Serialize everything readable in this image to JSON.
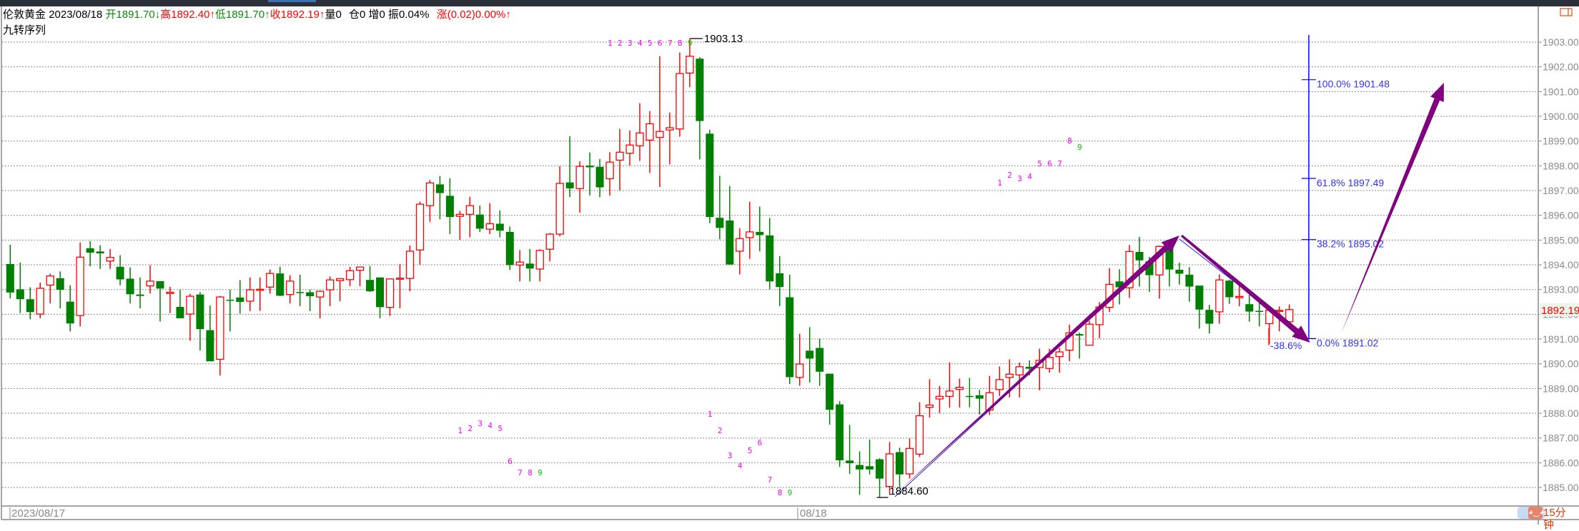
{
  "header": {
    "instrument": "伦敦黄金",
    "date": "2023/08/18",
    "open_label": "开",
    "open_value": "1891.70",
    "open_arrow": "↓",
    "high_label": "高",
    "high_value": "1892.40",
    "high_arrow": "↑",
    "low_label": "低",
    "low_value": "1891.70",
    "low_arrow": "↑",
    "close_label": "收",
    "close_value": "1892.19",
    "close_arrow": "↑",
    "volume": "量0",
    "position": "仓0",
    "increase": "增0",
    "amplitude": "振0.04%",
    "change": "涨(0.02)0.00%↑",
    "indicator": "九转序列"
  },
  "period_badge": "15分钟",
  "colors": {
    "up": "#ff0000",
    "down": "#008000",
    "arrow": "#800080",
    "fib": "#0000ff",
    "td": "#ff00ff",
    "td_nine": "#00cc00"
  },
  "chart_data": {
    "type": "candlestick",
    "title": "伦敦黄金",
    "ylim": [
      1884.45,
      1903.35
    ],
    "yticks": [
      1903,
      1902,
      1901,
      1900,
      1899,
      1898,
      1897,
      1896,
      1895,
      1894,
      1893,
      1892,
      1891,
      1890,
      1889,
      1888,
      1887,
      1886,
      1885
    ],
    "ytick_labels": [
      "1903.00",
      "1902.00",
      "1901.00",
      "1900.00",
      "1899.00",
      "1898.00",
      "1897.00",
      "1896.00",
      "1895.00",
      "1894.00",
      "1893.00",
      "1892.00",
      "1891.00",
      "1890.00",
      "1889.00",
      "1888.00",
      "1887.00",
      "1886.00",
      "1885.00"
    ],
    "x_labels": [
      {
        "candle": 1,
        "text": "2023/08/17"
      },
      {
        "candle": 79,
        "text": "08/18"
      }
    ],
    "last_price": "1892.19",
    "high_marker": {
      "candle": 69,
      "text": "1903.13"
    },
    "low_marker": {
      "candle": 88,
      "text": "1884.60"
    },
    "fibonacci": [
      {
        "label": "100.0% 1901.48",
        "price": 1901.48
      },
      {
        "label": "61.8% 1897.49",
        "price": 1897.49
      },
      {
        "label": "38.2% 1895.02",
        "price": 1895.02
      },
      {
        "label": "0.0% 1891.02",
        "price": 1891.02
      }
    ],
    "retrace_label": "-38.6%",
    "ohlc": [
      [
        1894.03,
        1894.81,
        1892.64,
        1892.88
      ],
      [
        1893.01,
        1894.09,
        1892.05,
        1892.61
      ],
      [
        1892.61,
        1893.09,
        1891.8,
        1892.09
      ],
      [
        1892.01,
        1893.28,
        1891.84,
        1893.05
      ],
      [
        1893.18,
        1893.64,
        1892.44,
        1893.55
      ],
      [
        1893.46,
        1893.73,
        1892.24,
        1892.99
      ],
      [
        1892.51,
        1893.18,
        1891.31,
        1891.63
      ],
      [
        1891.95,
        1894.9,
        1891.51,
        1894.31
      ],
      [
        1894.67,
        1894.96,
        1893.94,
        1894.49
      ],
      [
        1894.54,
        1894.79,
        1893.83,
        1894.46
      ],
      [
        1894.15,
        1894.64,
        1893.83,
        1894.3
      ],
      [
        1893.92,
        1894.39,
        1893.17,
        1893.41
      ],
      [
        1893.44,
        1893.9,
        1892.44,
        1892.81
      ],
      [
        1892.8,
        1893.49,
        1892.24,
        1892.74
      ],
      [
        1893.15,
        1893.98,
        1892.84,
        1893.34
      ],
      [
        1893.34,
        1893.34,
        1891.71,
        1893.04
      ],
      [
        1892.84,
        1893.11,
        1892.05,
        1892.89
      ],
      [
        1892.3,
        1892.99,
        1891.84,
        1891.84
      ],
      [
        1892.01,
        1892.83,
        1890.93,
        1892.73
      ],
      [
        1892.8,
        1892.9,
        1890.54,
        1891.4
      ],
      [
        1891.36,
        1892.36,
        1890.1,
        1890.1
      ],
      [
        1890.18,
        1892.74,
        1889.53,
        1892.7
      ],
      [
        1892.59,
        1892.99,
        1891.31,
        1892.57
      ],
      [
        1892.68,
        1893.38,
        1892.03,
        1892.5
      ],
      [
        1892.53,
        1893.49,
        1892.13,
        1892.99
      ],
      [
        1892.97,
        1893.49,
        1892.14,
        1893.01
      ],
      [
        1893.1,
        1893.81,
        1892.84,
        1893.65
      ],
      [
        1893.65,
        1893.92,
        1892.73,
        1892.75
      ],
      [
        1892.8,
        1893.58,
        1892.44,
        1893.34
      ],
      [
        1892.9,
        1893.6,
        1892.33,
        1892.89
      ],
      [
        1892.89,
        1892.99,
        1892.13,
        1892.73
      ],
      [
        1892.7,
        1892.96,
        1891.84,
        1892.93
      ],
      [
        1892.99,
        1893.53,
        1892.33,
        1893.39
      ],
      [
        1893.36,
        1893.45,
        1892.53,
        1893.44
      ],
      [
        1893.4,
        1893.92,
        1893.13,
        1893.76
      ],
      [
        1893.78,
        1893.92,
        1893.13,
        1893.91
      ],
      [
        1893.39,
        1893.95,
        1892.9,
        1892.93
      ],
      [
        1893.49,
        1893.49,
        1891.84,
        1892.29
      ],
      [
        1892.28,
        1893.45,
        1891.93,
        1893.43
      ],
      [
        1893.45,
        1894.03,
        1892.24,
        1893.46
      ],
      [
        1893.45,
        1894.78,
        1892.93,
        1894.55
      ],
      [
        1894.6,
        1896.55,
        1894.01,
        1896.45
      ],
      [
        1896.39,
        1897.43,
        1895.73,
        1897.31
      ],
      [
        1897.25,
        1897.59,
        1895.84,
        1896.9
      ],
      [
        1896.79,
        1897.5,
        1895.24,
        1895.93
      ],
      [
        1895.96,
        1896.18,
        1895.01,
        1896.04
      ],
      [
        1896.04,
        1896.75,
        1895.11,
        1896.39
      ],
      [
        1896.03,
        1896.4,
        1895.33,
        1895.46
      ],
      [
        1895.44,
        1896.49,
        1895.24,
        1895.66
      ],
      [
        1895.66,
        1896.2,
        1895.11,
        1895.38
      ],
      [
        1895.33,
        1895.55,
        1893.79,
        1893.99
      ],
      [
        1893.99,
        1894.6,
        1893.33,
        1894.11
      ],
      [
        1894.05,
        1894.64,
        1893.33,
        1893.85
      ],
      [
        1893.83,
        1894.63,
        1893.33,
        1894.58
      ],
      [
        1894.63,
        1895.28,
        1894.14,
        1895.24
      ],
      [
        1895.24,
        1897.98,
        1895.15,
        1897.29
      ],
      [
        1897.33,
        1899.2,
        1896.74,
        1897.09
      ],
      [
        1897.08,
        1898.18,
        1896.11,
        1897.98
      ],
      [
        1898.01,
        1898.54,
        1896.8,
        1897.94
      ],
      [
        1897.96,
        1898.28,
        1896.73,
        1897.13
      ],
      [
        1897.48,
        1898.55,
        1896.8,
        1898.15
      ],
      [
        1898.23,
        1899.49,
        1897.01,
        1898.55
      ],
      [
        1898.51,
        1899.43,
        1898.01,
        1898.84
      ],
      [
        1898.81,
        1900.53,
        1898.2,
        1899.33
      ],
      [
        1899.04,
        1900.21,
        1897.71,
        1899.7
      ],
      [
        1899.15,
        1902.43,
        1897.14,
        1899.39
      ],
      [
        1899.45,
        1900.15,
        1898.06,
        1899.54
      ],
      [
        1899.49,
        1902.58,
        1899.18,
        1901.73
      ],
      [
        1901.75,
        1903.13,
        1901.18,
        1902.43
      ],
      [
        1902.33,
        1902.39,
        1898.26,
        1899.81
      ],
      [
        1899.3,
        1899.46,
        1895.68,
        1895.93
      ],
      [
        1895.9,
        1897.6,
        1895.03,
        1895.49
      ],
      [
        1895.79,
        1897.18,
        1894.01,
        1894.01
      ],
      [
        1894.55,
        1895.48,
        1893.61,
        1895.06
      ],
      [
        1895.1,
        1896.55,
        1894.24,
        1895.33
      ],
      [
        1895.33,
        1896.35,
        1894.54,
        1895.2
      ],
      [
        1895.19,
        1895.89,
        1893.01,
        1893.33
      ],
      [
        1893.66,
        1894.35,
        1892.33,
        1893.1
      ],
      [
        1892.69,
        1893.6,
        1889.18,
        1889.46
      ],
      [
        1889.45,
        1891.21,
        1889.11,
        1889.99
      ],
      [
        1890.53,
        1891.48,
        1889.24,
        1890.21
      ],
      [
        1890.64,
        1891.01,
        1889.11,
        1889.68
      ],
      [
        1889.6,
        1889.6,
        1887.54,
        1888.14
      ],
      [
        1888.36,
        1888.49,
        1885.83,
        1886.1
      ],
      [
        1886.09,
        1887.53,
        1885.55,
        1885.98
      ],
      [
        1885.91,
        1886.46,
        1884.7,
        1885.73
      ],
      [
        1885.86,
        1886.94,
        1885.53,
        1885.73
      ],
      [
        1886.14,
        1886.18,
        1884.6,
        1885.36
      ],
      [
        1885.04,
        1886.84,
        1884.7,
        1886.36
      ],
      [
        1886.43,
        1886.61,
        1885.01,
        1885.53
      ],
      [
        1885.55,
        1886.98,
        1885.36,
        1886.58
      ],
      [
        1886.35,
        1888.45,
        1886.23,
        1887.9
      ],
      [
        1888.24,
        1889.38,
        1887.83,
        1888.33
      ],
      [
        1888.58,
        1889.11,
        1888.01,
        1888.68
      ],
      [
        1888.68,
        1890.06,
        1888.23,
        1888.9
      ],
      [
        1888.96,
        1889.4,
        1888.23,
        1889.05
      ],
      [
        1888.7,
        1889.43,
        1888.24,
        1888.68
      ],
      [
        1888.73,
        1888.95,
        1887.95,
        1888.59
      ],
      [
        1888.13,
        1889.51,
        1887.93,
        1888.83
      ],
      [
        1888.96,
        1889.89,
        1888.7,
        1889.36
      ],
      [
        1889.45,
        1890.18,
        1888.64,
        1889.58
      ],
      [
        1889.55,
        1890.05,
        1888.64,
        1889.88
      ],
      [
        1889.88,
        1890.14,
        1889.53,
        1889.8
      ],
      [
        1889.85,
        1890.61,
        1888.93,
        1890.14
      ],
      [
        1889.81,
        1890.61,
        1889.64,
        1890.26
      ],
      [
        1890.29,
        1890.64,
        1889.64,
        1890.48
      ],
      [
        1890.55,
        1891.58,
        1890.11,
        1891.25
      ],
      [
        1891.2,
        1891.26,
        1890.21,
        1891.14
      ],
      [
        1890.75,
        1891.74,
        1890.75,
        1891.6
      ],
      [
        1891.58,
        1892.49,
        1891.03,
        1892.3
      ],
      [
        1892.28,
        1893.86,
        1892.09,
        1893.21
      ],
      [
        1893.33,
        1893.82,
        1892.4,
        1893.09
      ],
      [
        1893.07,
        1894.8,
        1892.66,
        1894.54
      ],
      [
        1894.52,
        1895.13,
        1893.12,
        1894.18
      ],
      [
        1894.14,
        1894.32,
        1892.91,
        1893.58
      ],
      [
        1893.59,
        1894.77,
        1892.63,
        1894.74
      ],
      [
        1894.68,
        1894.7,
        1893.12,
        1893.81
      ],
      [
        1893.8,
        1894.09,
        1893.2,
        1893.64
      ],
      [
        1893.6,
        1893.91,
        1892.51,
        1893.12
      ],
      [
        1893.16,
        1893.16,
        1891.42,
        1892.19
      ],
      [
        1892.18,
        1892.38,
        1891.22,
        1891.62
      ],
      [
        1892.1,
        1893.61,
        1891.62,
        1893.39
      ],
      [
        1893.36,
        1893.4,
        1892.42,
        1892.69
      ],
      [
        1892.67,
        1893.18,
        1892.32,
        1892.72
      ],
      [
        1892.41,
        1892.8,
        1891.7,
        1892.11
      ],
      [
        1892.14,
        1892.49,
        1891.51,
        1892.12
      ],
      [
        1891.62,
        1892.16,
        1890.81,
        1892.16
      ],
      [
        1892.14,
        1892.32,
        1891.31,
        1892.16
      ],
      [
        1891.7,
        1892.4,
        1891.7,
        1892.19
      ]
    ],
    "td_sequences": [
      {
        "candles": [
          61,
          62,
          63,
          64,
          65,
          66,
          67,
          68,
          69
        ],
        "labels": [
          "1",
          "2",
          "3",
          "4",
          "5",
          "6",
          "7",
          "8",
          "9"
        ]
      },
      {
        "candles": [
          46,
          47,
          48,
          49,
          50,
          51,
          52,
          53,
          54
        ],
        "labels": [
          "1",
          "2",
          "3",
          "4",
          "5",
          "6",
          "7",
          "8",
          "9"
        ]
      },
      {
        "candles": [
          71,
          72,
          73,
          74,
          75,
          76,
          77,
          78,
          79
        ],
        "labels": [
          "1",
          "2",
          "3",
          "4",
          "5",
          "6",
          "7",
          "8",
          "9"
        ]
      },
      {
        "candles": [
          100,
          101,
          102,
          103,
          104,
          105,
          106,
          107,
          108
        ],
        "labels": [
          "1",
          "2",
          "3",
          "4",
          "5",
          "6",
          "7",
          "8",
          "9"
        ]
      }
    ]
  }
}
